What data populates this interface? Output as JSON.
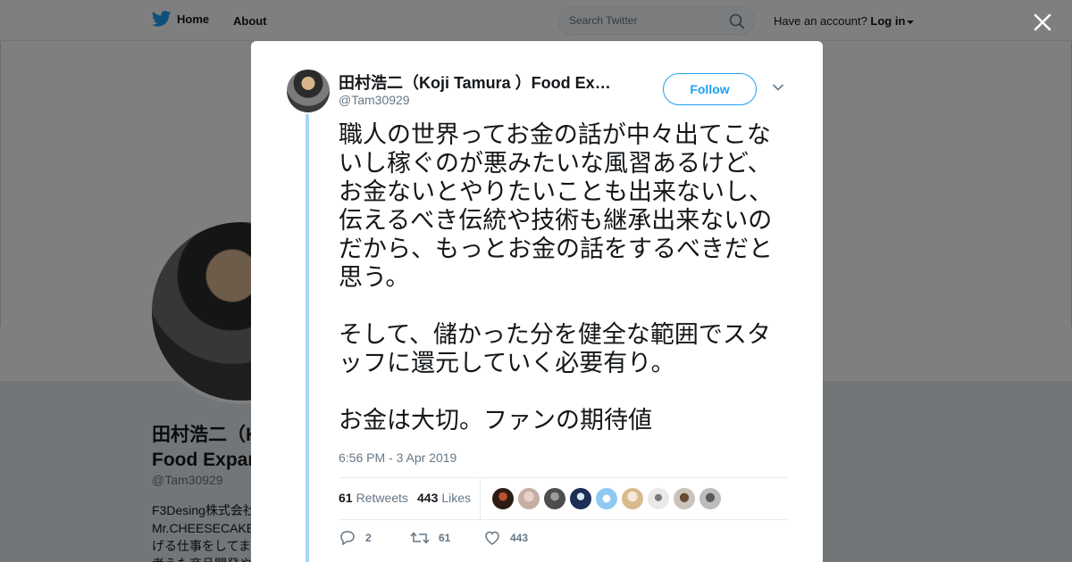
{
  "topbar": {
    "home_label": "Home",
    "about_label": "About",
    "search_placeholder": "Search Twitter",
    "account_prompt": "Have an account?",
    "login_label": "Log in"
  },
  "profile_background": {
    "name_line1": "田村浩二（K",
    "name_line2": "Food Expar",
    "handle": "@Tam30929",
    "bio_lines": [
      "F3Desing株式会社",
      "Mr.CHEESECAKE",
      "げる仕事をしてま",
      "考えた商品開発や"
    ]
  },
  "tweet": {
    "author_name": "田村浩二（Koji Tamura ）Food Experiencer",
    "author_handle": "@Tam30929",
    "follow_label": "Follow",
    "text": "職人の世界ってお金の話が中々出てこないし稼ぐのが悪みたいな風習あるけど、お金ないとやりたいことも出来ないし、伝えるべき伝統や技術も継承出来ないのだから、もっとお金の話をするべきだと思う。\n\nそして、儲かった分を健全な範囲でスタッフに還元していく必要有り。\n\nお金は大切。ファンの期待値",
    "timestamp": "6:56 PM - 3 Apr 2019",
    "retweets_count": "61",
    "retweets_label": "Retweets",
    "likes_count": "443",
    "likes_label": "Likes",
    "reply_count": "2",
    "retweet_action_count": "61",
    "like_action_count": "443"
  },
  "colors": {
    "accent": "#1da1f2",
    "thread_line": "#a9d6f3",
    "muted_text": "#657786",
    "primary_text": "#14171a",
    "overlay": "rgba(0,0,0,0.5)"
  },
  "icons": {
    "brand": "twitter-bird-icon",
    "search": "search-icon",
    "close": "close-icon",
    "more": "chevron-down-icon",
    "reply": "reply-icon",
    "retweet": "retweet-icon",
    "like": "heart-icon"
  }
}
